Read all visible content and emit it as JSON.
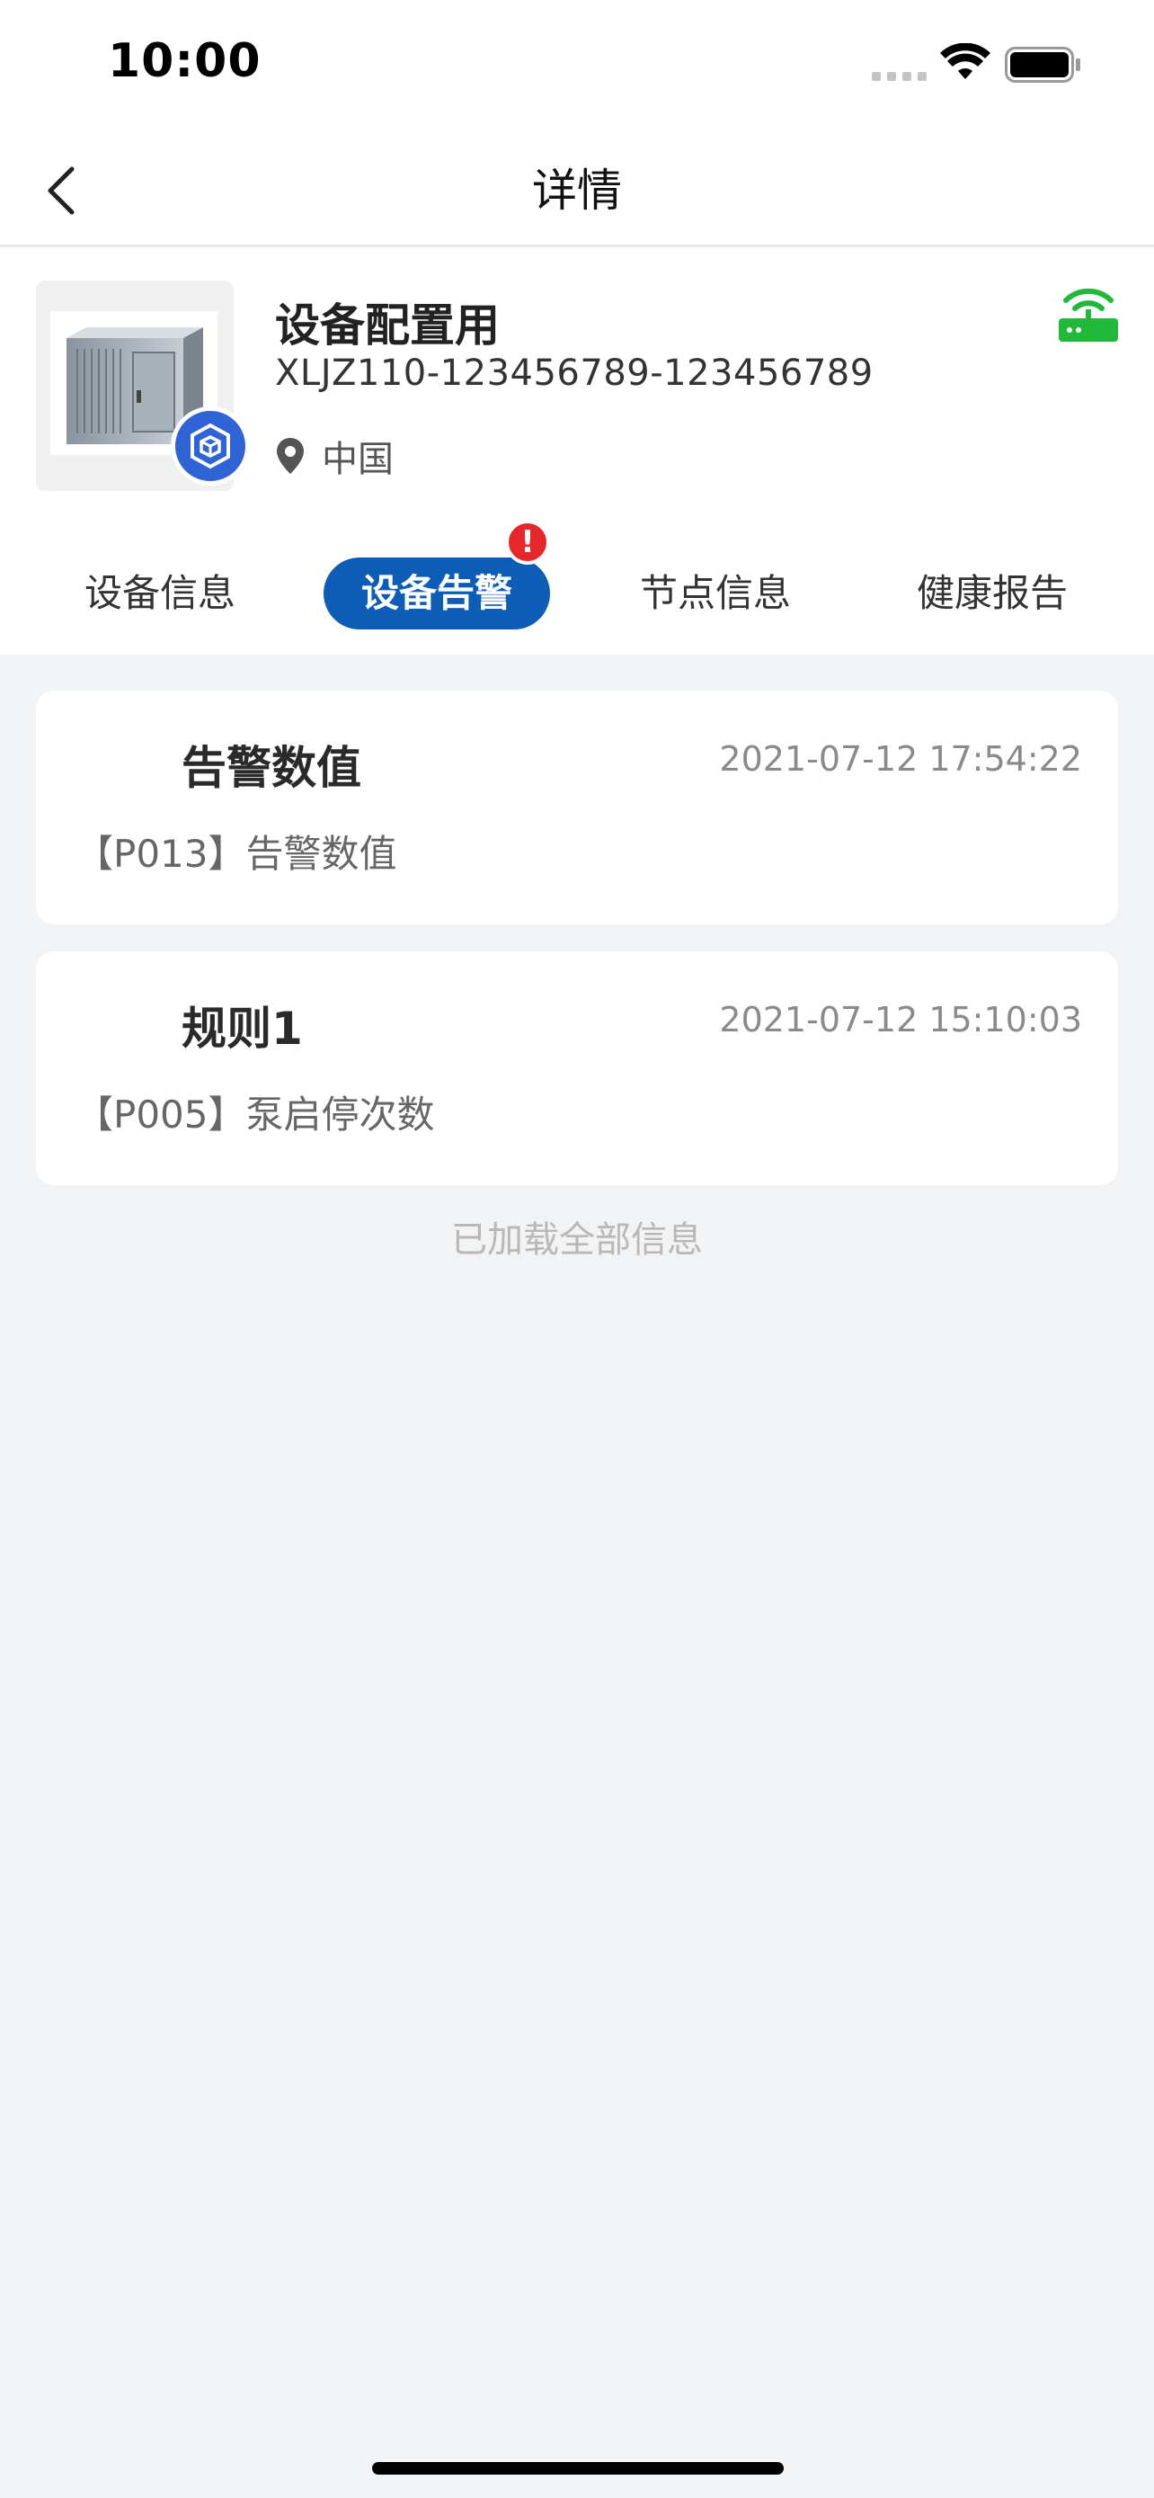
{
  "status_bar": {
    "time": "10:00"
  },
  "nav": {
    "title": "详情"
  },
  "device": {
    "name": "设备配置用",
    "serial": "XLJZ110-123456789-123456789",
    "location": "中国"
  },
  "tabs": [
    {
      "label": "设备信息",
      "active": false
    },
    {
      "label": "设备告警",
      "active": true,
      "alert": "!"
    },
    {
      "label": "节点信息",
      "active": false
    },
    {
      "label": "健康报告",
      "active": false
    }
  ],
  "alarms": [
    {
      "title": "告警数值",
      "time": "2021-07-12 17:54:22",
      "desc": "【P013】告警数值"
    },
    {
      "title": "规则1",
      "time": "2021-07-12 15:10:03",
      "desc": "【P005】泵启停次数"
    }
  ],
  "footer_note": "已加载全部信息",
  "colors": {
    "accent": "#0d5cb6",
    "online": "#22b83a",
    "alert": "#e5262a",
    "brand": "#2f63d6"
  }
}
